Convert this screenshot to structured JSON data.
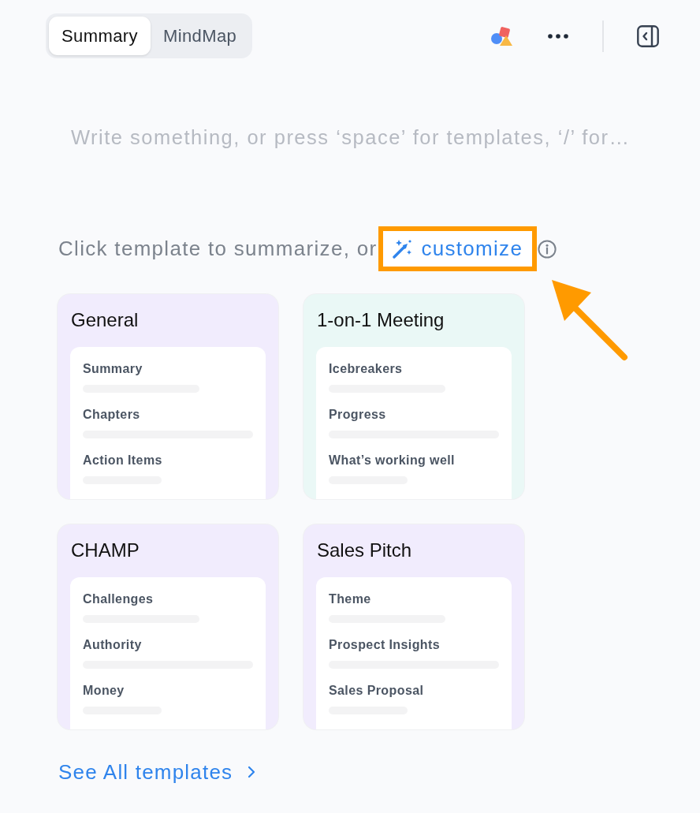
{
  "tabs": [
    {
      "label": "Summary",
      "selected": true
    },
    {
      "label": "MindMap",
      "selected": false
    }
  ],
  "editor": {
    "placeholder": "Write something, or press ‘space’ for templates, ‘/’ for…"
  },
  "template_prompt": {
    "text": "Click template to summarize, or",
    "link": "customize",
    "highlighted": true
  },
  "templates": [
    {
      "title": "General",
      "color": "#f1ecfd",
      "sections": [
        "Summary",
        "Chapters",
        "Action Items"
      ]
    },
    {
      "title": "1-on-1 Meeting",
      "color": "#eaf8f6",
      "sections": [
        "Icebreakers",
        "Progress",
        "What’s working well"
      ]
    },
    {
      "title": "CHAMP",
      "color": "#f1ecfd",
      "sections": [
        "Challenges",
        "Authority",
        "Money"
      ]
    },
    {
      "title": "Sales Pitch",
      "color": "#f1ecfd",
      "sections": [
        "Theme",
        "Prospect Insights",
        "Sales Proposal"
      ]
    }
  ],
  "see_all": {
    "label": "See All templates"
  }
}
